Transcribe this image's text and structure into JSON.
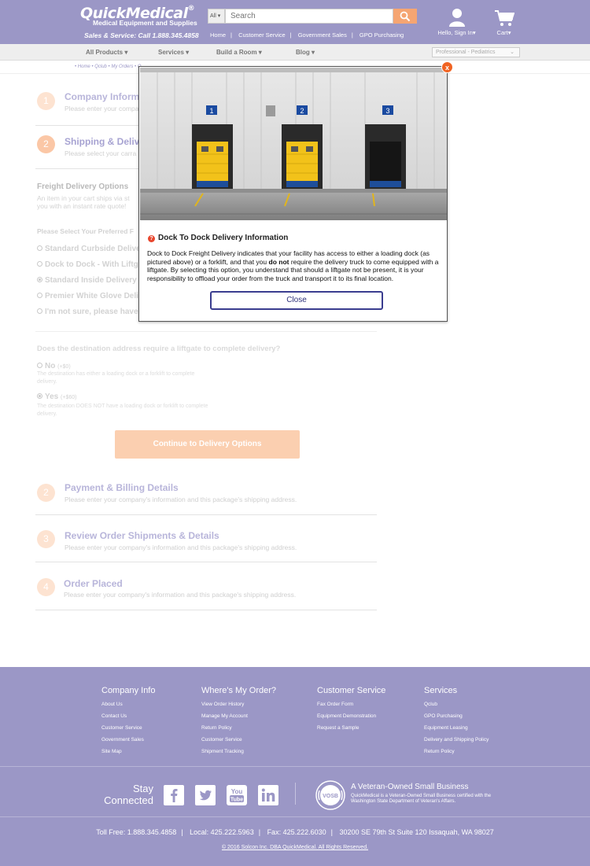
{
  "header": {
    "logo": "QuickMedical",
    "logo_reg": "®",
    "tagline": "Medical Equipment and Supplies",
    "sales": "Sales & Service: Call 1.888.345.4858",
    "search_scope": "All",
    "search_placeholder": "Search",
    "nav": [
      "Home",
      "Customer Service",
      "Government Sales",
      "GPO Purchasing"
    ],
    "user_label": "Hello, Sign In",
    "cart_label": "Cart"
  },
  "subnav": {
    "items": [
      "All Products",
      "Services",
      "Build a Room",
      "Blog"
    ],
    "profession": "Professional - Pediatrics"
  },
  "breadcrumb": "• Home • Qclub • My Orders • O",
  "steps": [
    {
      "num": "1",
      "title": "Company Informa",
      "sub": "Please enter your compa"
    },
    {
      "num": "2",
      "title": "Shipping & Delive",
      "sub": "Please select your carra"
    }
  ],
  "freight": {
    "title": "Freight Delivery Options",
    "desc1": "An item in your cart ships via st",
    "desc2": "you with an instant rate quote!",
    "preferred": "Please Select Your Preferred F",
    "options": [
      {
        "label": "Standard Curbside Delive",
        "checked": false
      },
      {
        "label": "Dock to Dock - With Liftga",
        "checked": false
      },
      {
        "label": "Standard Inside Delivery",
        "checked": true
      },
      {
        "label": "Premier White Glove Deliv",
        "checked": false
      },
      {
        "label": "I'm not sure, please have",
        "checked": false
      }
    ]
  },
  "liftgate": {
    "question": "Does the destination address require a liftgate to complete delivery?",
    "no_label": "No",
    "no_price": "(+$0)",
    "no_note": "The destination has either a loading dock or a forklift to complete delivery.",
    "yes_label": "Yes",
    "yes_price": "(+$60)",
    "yes_note": "The destination DOES NOT have a loading dock or forklift to complete delivery."
  },
  "continue_label": "Continue to Delivery Options",
  "later_steps": [
    {
      "num": "2",
      "title": "Payment & Billing Details",
      "sub": "Please enter your company's information and this package's shipping address."
    },
    {
      "num": "3",
      "title": "Review Order Shipments & Details",
      "sub": "Please enter your company's information and this package's shipping address."
    },
    {
      "num": "4",
      "title": "Order Placed",
      "sub": "Please enter your company's information and this package's shipping address."
    }
  ],
  "modal": {
    "close_x": "x",
    "dock_numbers": [
      "1",
      "2",
      "3"
    ],
    "title": "Dock To Dock Delivery Information",
    "body_pre": "Dock to Dock Freight Delivery indicates that your facility has access to either a loading dock (as pictured above) or a forklift, and that you ",
    "body_bold": "do not",
    "body_post": " require the delivery truck to come equipped with a liftgate. By selecting this option, you understand that should a liftgate not be present, it is your responsibility to offload your order from the truck and transport it to its final location.",
    "close_label": "Close"
  },
  "footer": {
    "columns": [
      {
        "title": "Company Info",
        "links": [
          "About Us",
          "Contact Us",
          "Customer Service",
          "Government Sales",
          "Site Map"
        ]
      },
      {
        "title": "Where's My Order?",
        "links": [
          "View Order History",
          "Manage My Account",
          "Return Policy",
          "Customer Service",
          "Shipment Tracking"
        ]
      },
      {
        "title": "Customer Service",
        "links": [
          "Fax Order Form",
          "Equipment Demonstration",
          "Request a Sample"
        ]
      },
      {
        "title": "Services",
        "links": [
          "Qclub",
          "GPO Purchasing",
          "Equipment Leasing",
          "Delivery and Shipping Policy",
          "Return Policy"
        ]
      }
    ],
    "stay1": "Stay",
    "stay2": "Connected",
    "social": [
      "facebook-icon",
      "twitter-icon",
      "youtube-icon",
      "linkedin-icon"
    ],
    "vosb_badge": "VOSB",
    "vosb_title": "A Veteran-Owned Small Business",
    "vosb_desc": "QuickMedical is a Veteran-Owned Small Business certified with the Washington State Department of Veteran's Affairs.",
    "toll_free": "Toll Free: 1.888.345.4858",
    "local": "Local: 425.222.5963",
    "fax": "Fax: 425.222.6030",
    "address": "30200 SE 79th St Suite 120 Issaquah, WA 98027",
    "copyright": "© 2016 Solcon Inc. DBA QuickMedical. All Rights Reserved."
  },
  "colors": {
    "brand": "#9b97c6",
    "accent": "#f5a572",
    "close_x": "#f06322",
    "close_btn_border": "#3a3d8f"
  }
}
